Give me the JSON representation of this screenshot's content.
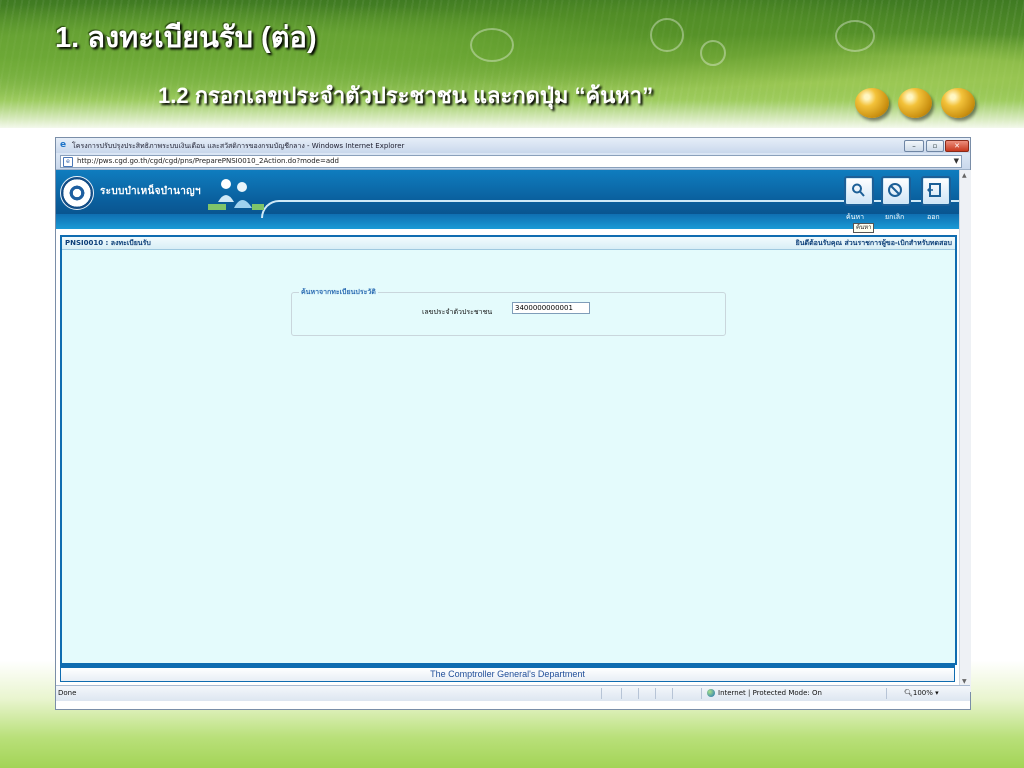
{
  "slide": {
    "title": "1. ลงทะเบียนรับ (ต่อ)",
    "subtitle": "1.2 กรอกเลขประจำตัวประชาชน และกดปุ่ม “ค้นหา”"
  },
  "browser": {
    "window_title": "โครงการปรับปรุงประสิทธิภาพระบบเงินเดือน และสวัสดิการของกรมบัญชีกลาง - Windows Internet Explorer",
    "address": "http://pws.cgd.go.th/cgd/cgd/pns/PreparePNSI0010_2Action.do?mode=add",
    "status_text": "Done",
    "zone_text": "Internet | Protected Mode: On",
    "zoom": "100%"
  },
  "app": {
    "system_name": "ระบบบำเหน็จบำนาญฯ",
    "toolbar": {
      "search_label": "ค้นหา",
      "cancel_label": "ยกเลิก",
      "exit_label": "ออก",
      "tooltip": "ค้นหา"
    },
    "panel": {
      "screen_id": "PNSI0010 : ลงทะเบียนรับ",
      "welcome": "ยินดีต้อนรับคุณ ส่วนราชการผู้ขอ-เบิกสำหรับทดสอบ",
      "search_legend": "ค้นหาจากทะเบียนประวัติ",
      "id_label": "เลขประจำตัวประชาชน",
      "id_value": "3400000000001"
    },
    "footer": "The Comptroller General's Department"
  },
  "colors": {
    "header_blue": "#0a5d9b",
    "panel_bg": "#e4fbfc",
    "accent_gold": "#f3c23a"
  }
}
